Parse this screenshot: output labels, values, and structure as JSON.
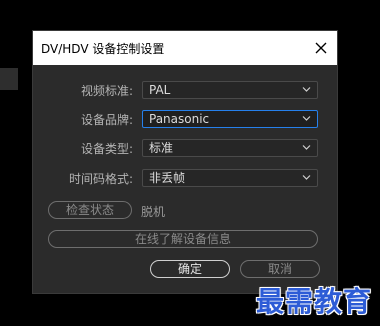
{
  "dialog": {
    "title": "DV/HDV 设备控制设置",
    "rows": [
      {
        "label": "视频标准:",
        "value": "PAL"
      },
      {
        "label": "设备品牌:",
        "value": "Panasonic"
      },
      {
        "label": "设备类型:",
        "value": "标准"
      },
      {
        "label": "时间码格式:",
        "value": "非丢帧"
      }
    ],
    "check_status_label": "检查状态",
    "status_value": "脱机",
    "online_info_label": "在线了解设备信息",
    "ok_label": "确定",
    "cancel_label": "取消"
  },
  "watermark": {
    "text": "最需教育",
    "color": "#2d5cd6"
  },
  "colors": {
    "focus_border": "#2680eb",
    "dialog_bg": "#2b2b2b"
  }
}
